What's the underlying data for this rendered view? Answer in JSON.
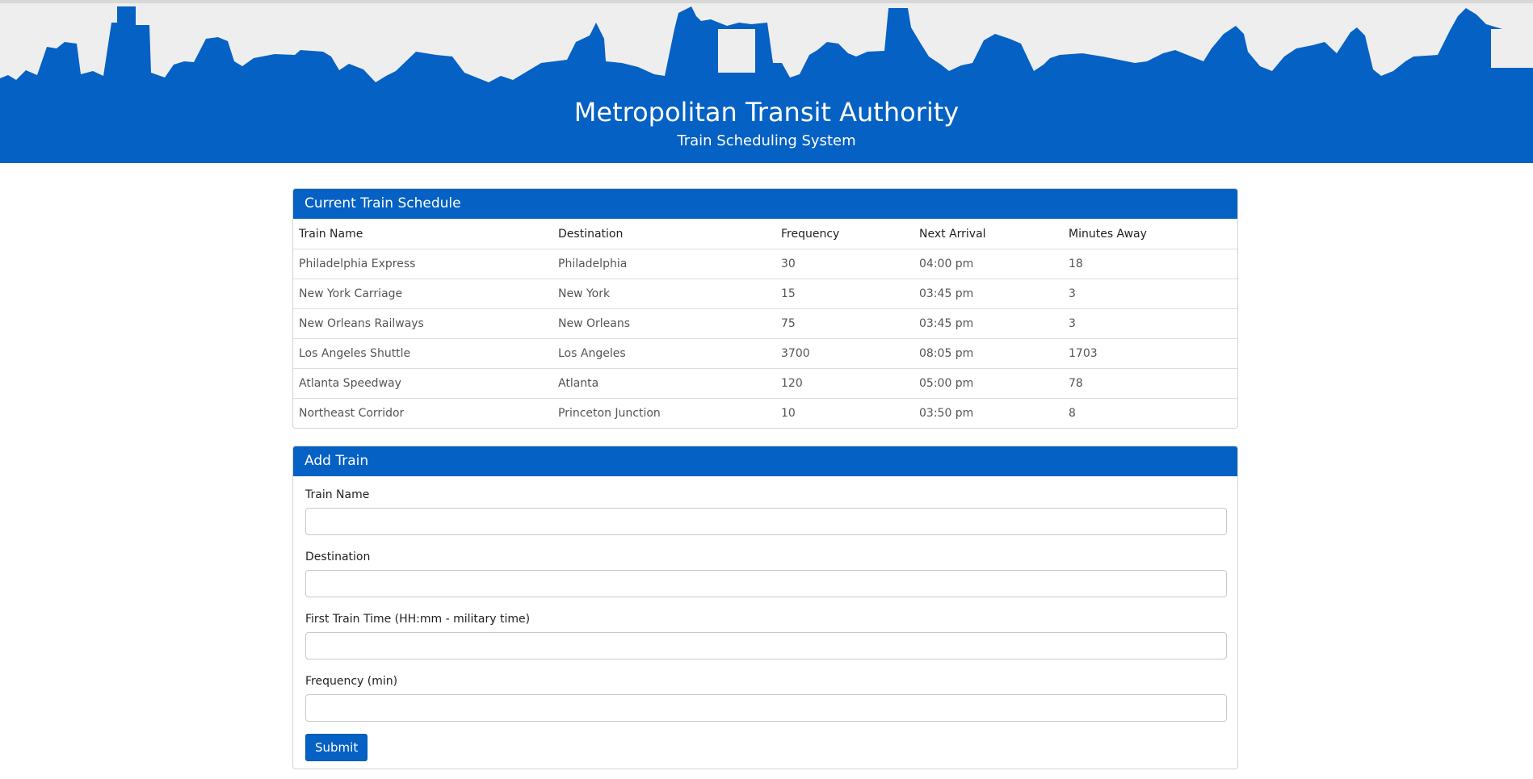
{
  "header": {
    "title": "Metropolitan Transit Authority",
    "subtitle": "Train Scheduling System"
  },
  "colors": {
    "brand_blue": "#0561c3",
    "sky_gray": "#eeeeee"
  },
  "schedule": {
    "heading": "Current Train Schedule",
    "columns": [
      "Train Name",
      "Destination",
      "Frequency",
      "Next Arrival",
      "Minutes Away"
    ],
    "rows": [
      [
        "Philadelphia Express",
        "Philadelphia",
        "30",
        "04:00 pm",
        "18"
      ],
      [
        "New York Carriage",
        "New York",
        "15",
        "03:45 pm",
        "3"
      ],
      [
        "New Orleans Railways",
        "New Orleans",
        "75",
        "03:45 pm",
        "3"
      ],
      [
        "Los Angeles Shuttle",
        "Los Angeles",
        "3700",
        "08:05 pm",
        "1703"
      ],
      [
        "Atlanta Speedway",
        "Atlanta",
        "120",
        "05:00 pm",
        "78"
      ],
      [
        "Northeast Corridor",
        "Princeton Junction",
        "10",
        "03:50 pm",
        "8"
      ]
    ]
  },
  "form": {
    "heading": "Add Train",
    "fields": [
      {
        "label": "Train Name",
        "value": "",
        "placeholder": ""
      },
      {
        "label": "Destination",
        "value": "",
        "placeholder": ""
      },
      {
        "label": "First Train Time (HH:mm - military time)",
        "value": "",
        "placeholder": ""
      },
      {
        "label": "Frequency (min)",
        "value": "",
        "placeholder": ""
      }
    ],
    "submit_label": "Submit"
  }
}
